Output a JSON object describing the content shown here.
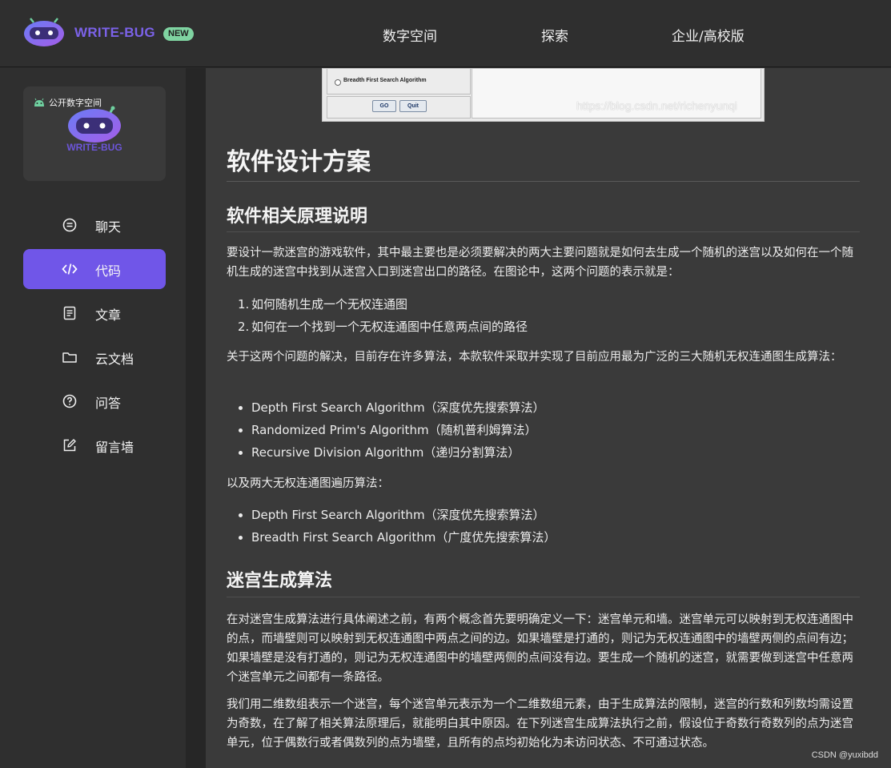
{
  "header": {
    "logo_text": "WRITE-BUG",
    "new_badge": "NEW",
    "nav": [
      "数字空间",
      "探索",
      "企业/高校版"
    ]
  },
  "sidebar": {
    "space_card": {
      "badge": "公开数字空间",
      "logo_text": "WRITE-BUG"
    },
    "items": [
      {
        "label": "聊天",
        "icon": "chat-icon",
        "active": false
      },
      {
        "label": "代码",
        "icon": "code-icon",
        "active": true
      },
      {
        "label": "文章",
        "icon": "article-icon",
        "active": false
      },
      {
        "label": "云文档",
        "icon": "folder-icon",
        "active": false
      },
      {
        "label": "问答",
        "icon": "question-icon",
        "active": false
      },
      {
        "label": "留言墙",
        "icon": "edit-icon",
        "active": false
      }
    ]
  },
  "screenshot": {
    "radio_label": "Breadth First Search Algorithm",
    "go_button": "GO",
    "quit_button": "Quit",
    "watermark": "https://blog.csdn.net/richenyunqi"
  },
  "article": {
    "h1": "软件设计方案",
    "section1": {
      "title": "软件相关原理说明",
      "p1": "要设计一款迷宫的游戏软件，其中最主要也是必须要解决的两大主要问题就是如何去生成一个随机的迷宫以及如何在一个随机生成的迷宫中找到从迷宫入口到迷宫出口的路径。在图论中，这两个问题的表示就是：",
      "ol": [
        "如何随机生成一个无权连通图",
        "如何在一个找到一个无权连通图中任意两点间的路径"
      ],
      "p2": "关于这两个问题的解决，目前存在许多算法，本款软件采取并实现了目前应用最为广泛的三大随机无权连通图生成算法：",
      "ul1": [
        "Depth First Search Algorithm（深度优先搜索算法）",
        "Randomized Prim's Algorithm（随机普利姆算法）",
        "Recursive Division Algorithm（递归分割算法）"
      ],
      "p3": "以及两大无权连通图遍历算法：",
      "ul2": [
        "Depth First Search Algorithm（深度优先搜索算法）",
        "Breadth First Search Algorithm（广度优先搜索算法）"
      ]
    },
    "section2": {
      "title": "迷宫生成算法",
      "p1": "在对迷宫生成算法进行具体阐述之前，有两个概念首先要明确定义一下：迷宫单元和墙。迷宫单元可以映射到无权连通图中的点，而墙壁则可以映射到无权连通图中两点之间的边。如果墙壁是打通的，则记为无权连通图中的墙壁两侧的点间有边；如果墙壁是没有打通的，则记为无权连通图中的墙壁两侧的点间没有边。要生成一个随机的迷宫，就需要做到迷宫中任意两个迷宫单元之间都有一条路径。",
      "p2": "我们用二维数组表示一个迷宫，每个迷宫单元表示为一个二维数组元素，由于生成算法的限制，迷宫的行数和列数均需设置为奇数，在了解了相关算法原理后，就能明白其中原因。在下列迷宫生成算法执行之前，假设位于奇数行奇数列的点为迷宫单元，位于偶数行或者偶数列的点为墙壁，且所有的点均初始化为未访问状态、不可通过状态。"
    }
  },
  "footer_watermark": "CSDN @yuxibdd",
  "colors": {
    "accent": "#7056e8",
    "brand_text": "#7b62e8",
    "new_badge": "#7fd3a1"
  }
}
